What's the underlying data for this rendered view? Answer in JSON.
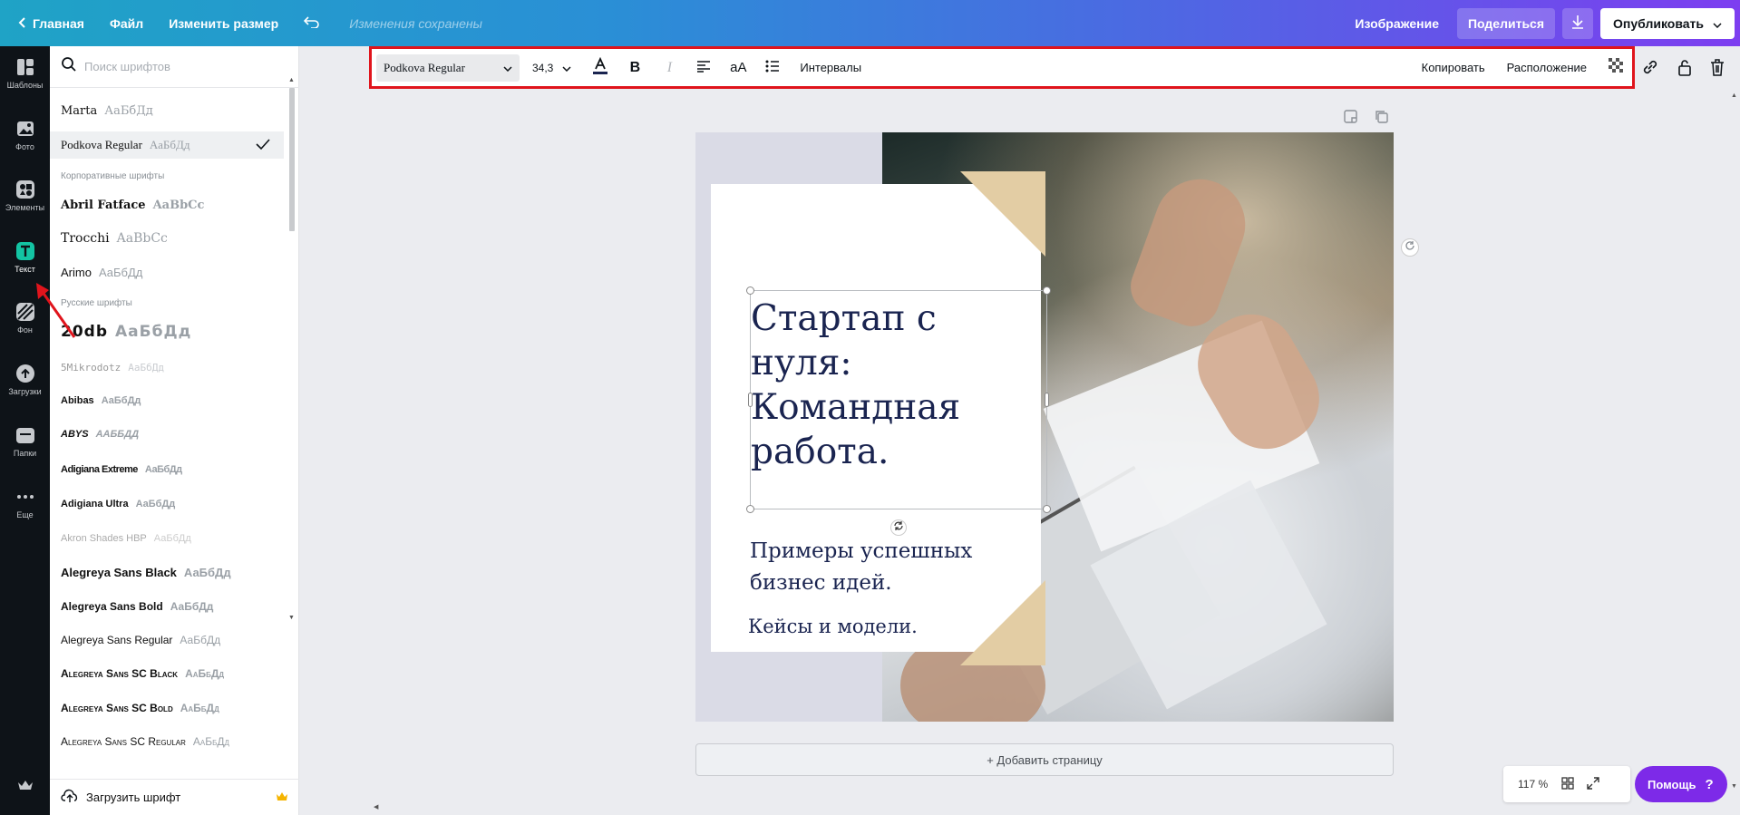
{
  "topbar": {
    "home": "Главная",
    "file": "Файл",
    "resize": "Изменить размер",
    "saved_status": "Изменения сохранены",
    "image": "Изображение",
    "share": "Поделиться",
    "publish": "Опубликовать"
  },
  "rail": {
    "items": [
      {
        "label": "Шаблоны",
        "icon": "templates-icon"
      },
      {
        "label": "Фото",
        "icon": "photo-icon"
      },
      {
        "label": "Элементы",
        "icon": "elements-icon"
      },
      {
        "label": "Текст",
        "icon": "text-icon",
        "active": true
      },
      {
        "label": "Фон",
        "icon": "background-icon"
      },
      {
        "label": "Загрузки",
        "icon": "uploads-icon"
      },
      {
        "label": "Папки",
        "icon": "folders-icon"
      },
      {
        "label": "Еще",
        "icon": "more-icon"
      }
    ]
  },
  "panel": {
    "search_placeholder": "Поиск шрифтов",
    "fonts_top": [
      {
        "name": "Marta",
        "preview": "АаБбДд"
      },
      {
        "name": "Podkova Regular",
        "preview": "АаБбДд",
        "selected": true
      }
    ],
    "section_corporate": "Корпоративные шрифты",
    "fonts_corporate": [
      {
        "name": "Abril Fatface",
        "preview": "AaBbCc"
      },
      {
        "name": "Trocchi",
        "preview": "AaBbCc"
      },
      {
        "name": "Arimo",
        "preview": "АаБбДд"
      }
    ],
    "section_russian": "Русские шрифты",
    "fonts_russian": [
      {
        "name": "20db",
        "preview": "АаБбДд"
      },
      {
        "name": "5Mikrodotz",
        "preview": "АаБбДд"
      },
      {
        "name": "Abibas",
        "preview": "АаБбДд"
      },
      {
        "name": "ABYS",
        "preview": "ААББДД"
      },
      {
        "name": "Adigiana Extreme",
        "preview": "АаБбДд"
      },
      {
        "name": "Adigiana Ultra",
        "preview": "АаБбДд"
      },
      {
        "name": "Akron Shades HBP",
        "preview": "АаБбДд"
      },
      {
        "name": "Alegreya Sans Black",
        "preview": "АаБбДд"
      },
      {
        "name": "Alegreya Sans Bold",
        "preview": "АаБбДд"
      },
      {
        "name": "Alegreya Sans Regular",
        "preview": "АаБбДд"
      },
      {
        "name": "Alegreya Sans SC Black",
        "preview": "АаБбДд"
      },
      {
        "name": "Alegreya Sans SC Bold",
        "preview": "АаБбДд"
      },
      {
        "name": "Alegreya Sans SC Regular",
        "preview": "АаБбДд"
      }
    ],
    "upload_font": "Загрузить шрифт"
  },
  "toolbar": {
    "font": "Podkova Regular",
    "size": "34,3",
    "case_label": "aA",
    "spacing": "Интервалы",
    "copy": "Копировать",
    "position": "Расположение"
  },
  "design": {
    "title": "Стартап с нуля: Командная работа.",
    "subtitle": "Примеры успешных бизнес идей.",
    "subtitle2": "Кейсы и модели."
  },
  "add_page": "+ Добавить страницу",
  "zoom": "117 %",
  "help": "Помощь",
  "help_q": "?",
  "colors": {
    "accent_purple": "#7d2ae8",
    "highlight_red": "#e0141c",
    "text_teal": "#13c4a3",
    "title_navy": "#1a2450",
    "beige": "#e3cda4"
  }
}
